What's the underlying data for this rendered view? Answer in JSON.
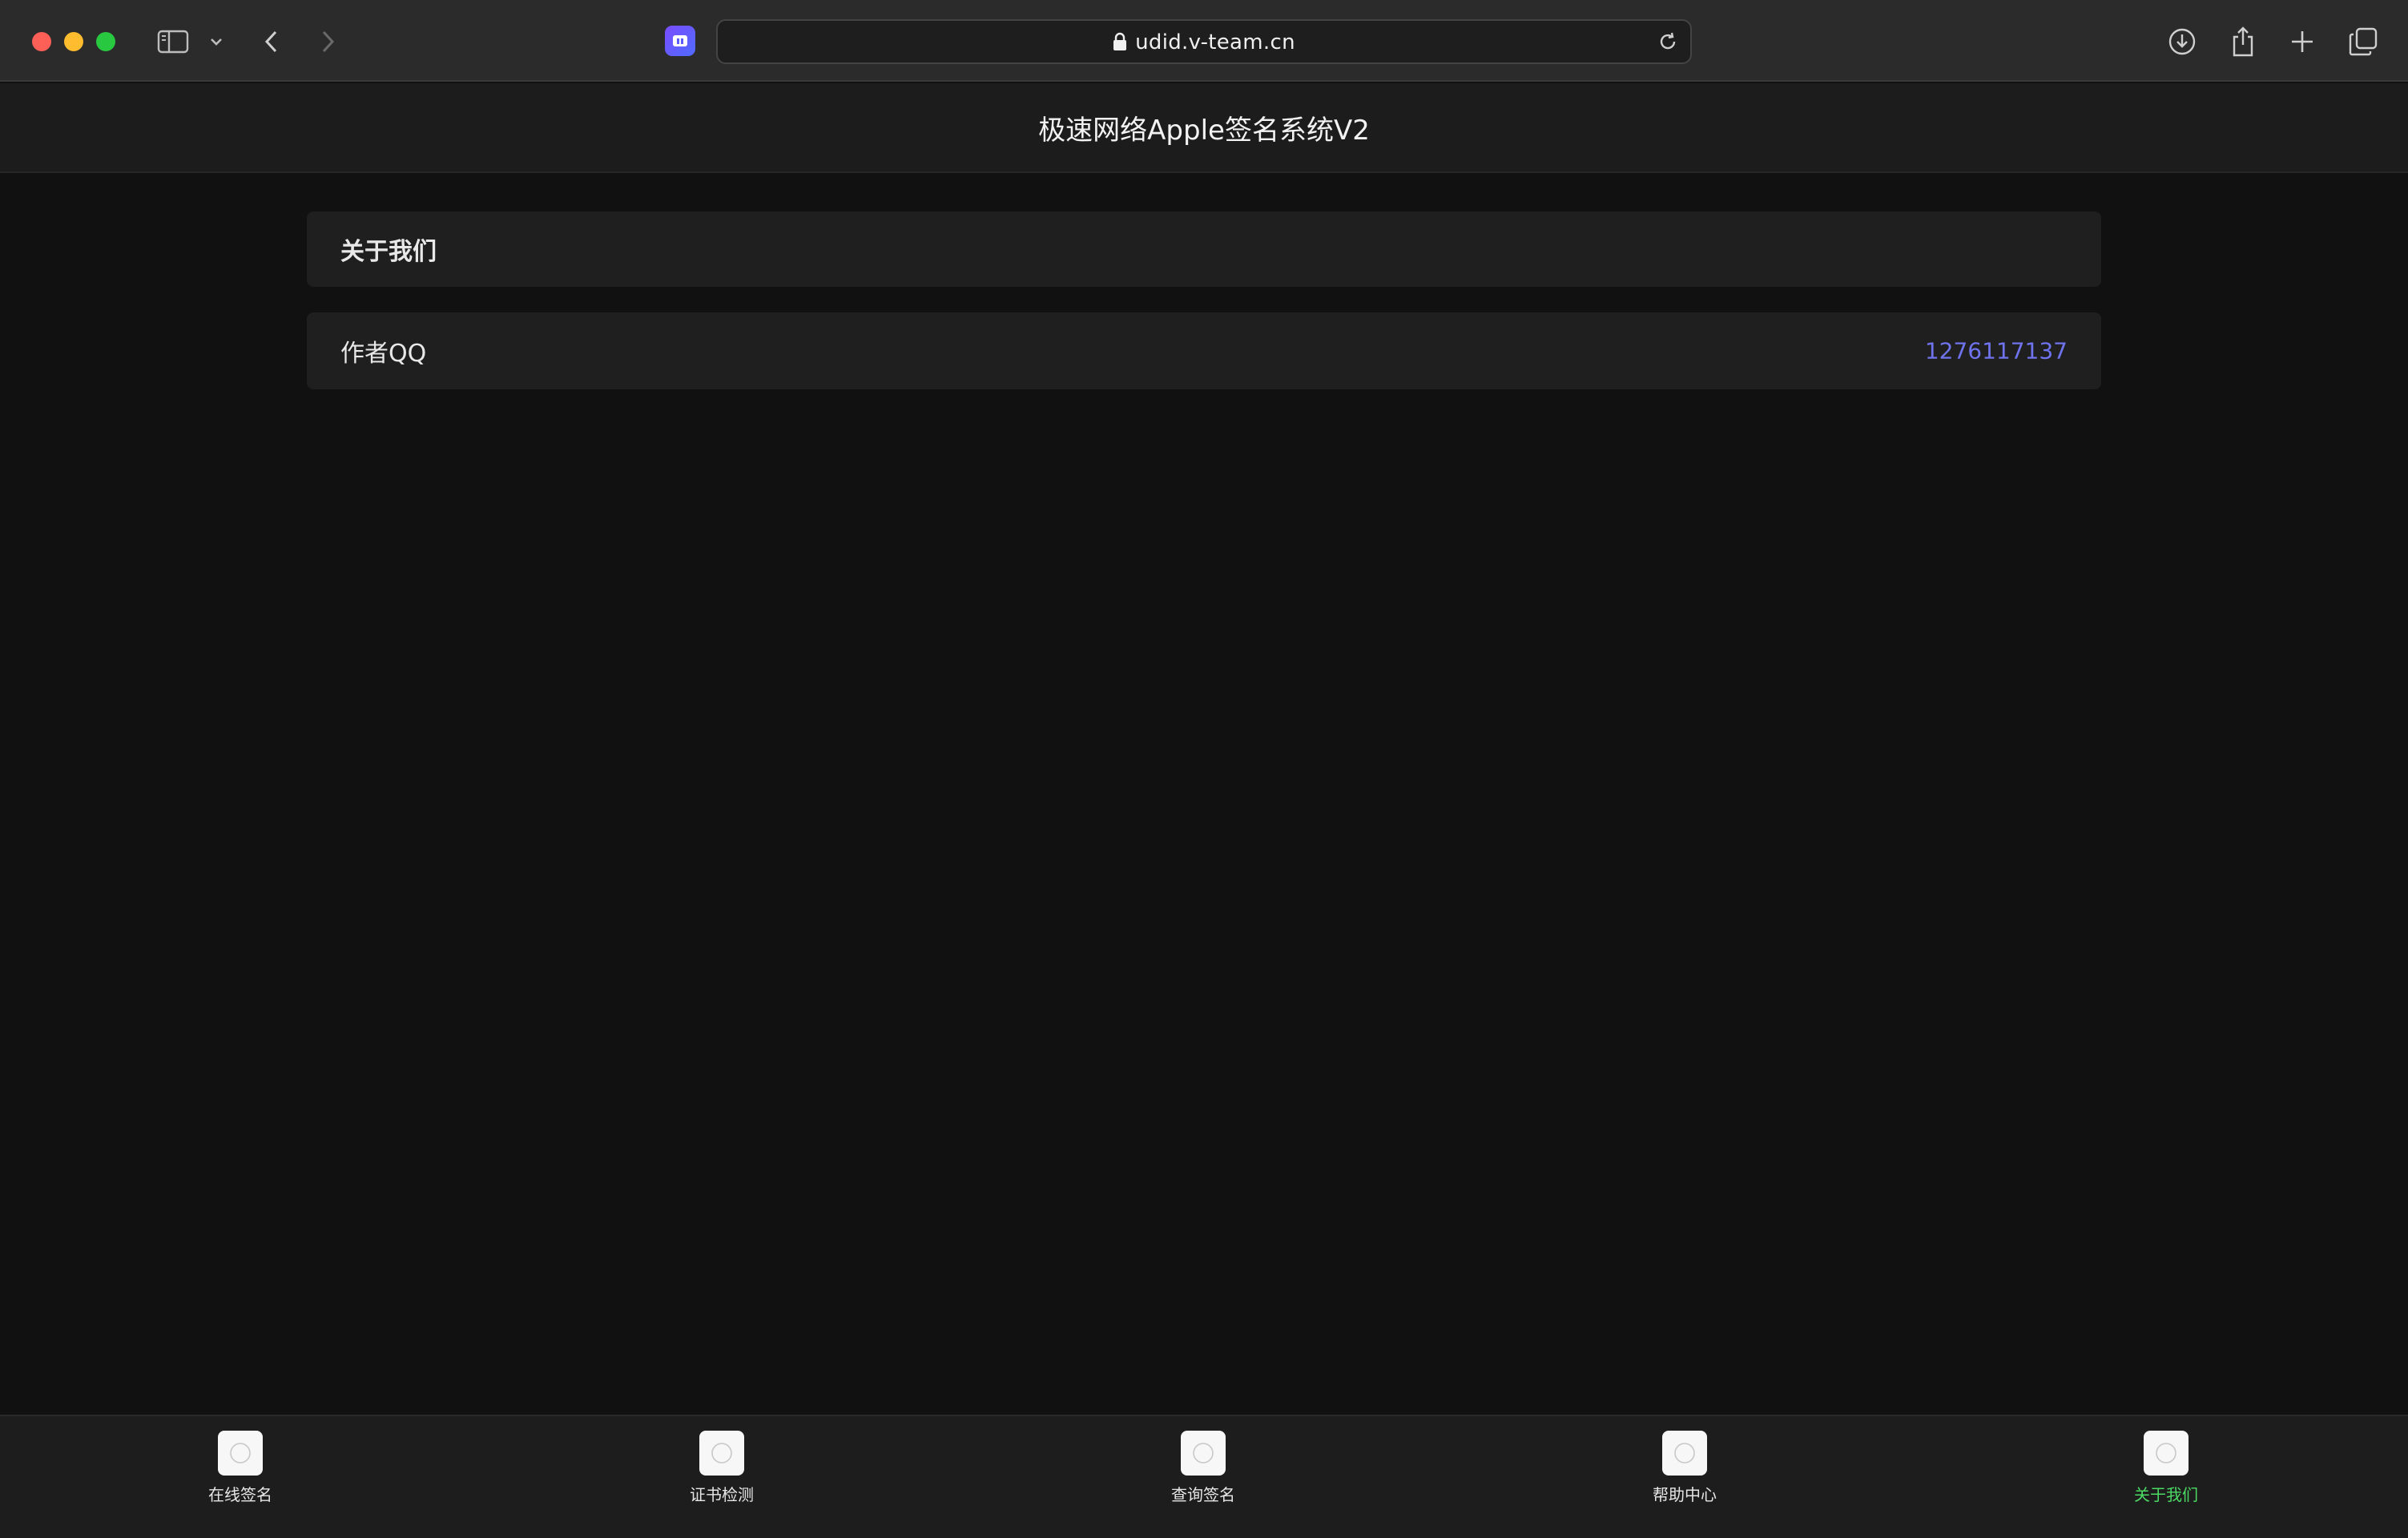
{
  "browser": {
    "url": "udid.v-team.cn"
  },
  "header": {
    "title": "极速网络Apple签名系统V2"
  },
  "about_card": {
    "title": "关于我们"
  },
  "qq_card": {
    "label": "作者QQ",
    "value": "1276117137"
  },
  "tabs": [
    {
      "label": "在线签名",
      "active": false
    },
    {
      "label": "证书检测",
      "active": false
    },
    {
      "label": "查询签名",
      "active": false
    },
    {
      "label": "帮助中心",
      "active": false
    },
    {
      "label": "关于我们",
      "active": true
    }
  ],
  "colors": {
    "active_tab": "#4cd964",
    "link": "#6f74ee"
  }
}
